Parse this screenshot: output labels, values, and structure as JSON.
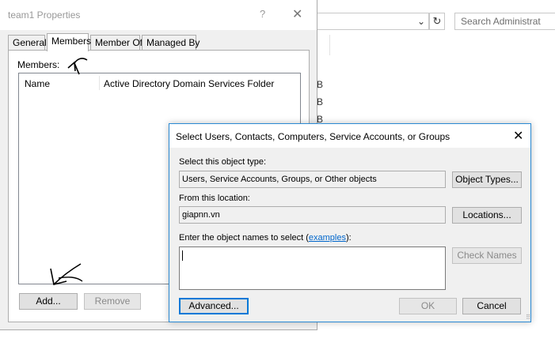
{
  "background_window": {
    "search_placeholder": "Search Administrat",
    "refresh_glyph": "↻",
    "chevron_glyph": "⌄",
    "fragments": [
      "B",
      "B",
      "B"
    ]
  },
  "properties_dialog": {
    "title": "team1 Properties",
    "help_glyph": "?",
    "close_glyph": "✕",
    "tabs": [
      {
        "label": "General",
        "active": false
      },
      {
        "label": "Members",
        "active": true
      },
      {
        "label": "Member Of",
        "active": false
      },
      {
        "label": "Managed By",
        "active": false
      }
    ],
    "members_label": "Members:",
    "columns": [
      "Name",
      "Active Directory Domain Services Folder"
    ],
    "add_button": "Add...",
    "remove_button": "Remove"
  },
  "select_dialog": {
    "title": "Select Users, Contacts, Computers, Service Accounts, or Groups",
    "close_glyph": "✕",
    "object_type_label": "Select this object type:",
    "object_type_value": "Users, Service Accounts, Groups, or Other objects",
    "object_types_button": "Object Types...",
    "location_label": "From this location:",
    "location_value": "giapnn.vn",
    "locations_button": "Locations...",
    "enter_names_prefix": "Enter the object names to select (",
    "examples_link": "examples",
    "enter_names_suffix": "):",
    "names_value": "",
    "check_names_button": "Check Names",
    "advanced_button": "Advanced...",
    "ok_button": "OK",
    "cancel_button": "Cancel"
  },
  "colors": {
    "dialog_bg": "#f0f0f0",
    "focus_blue": "#0078d7",
    "link_blue": "#0066cc",
    "disabled_text": "#8a8a8a"
  }
}
